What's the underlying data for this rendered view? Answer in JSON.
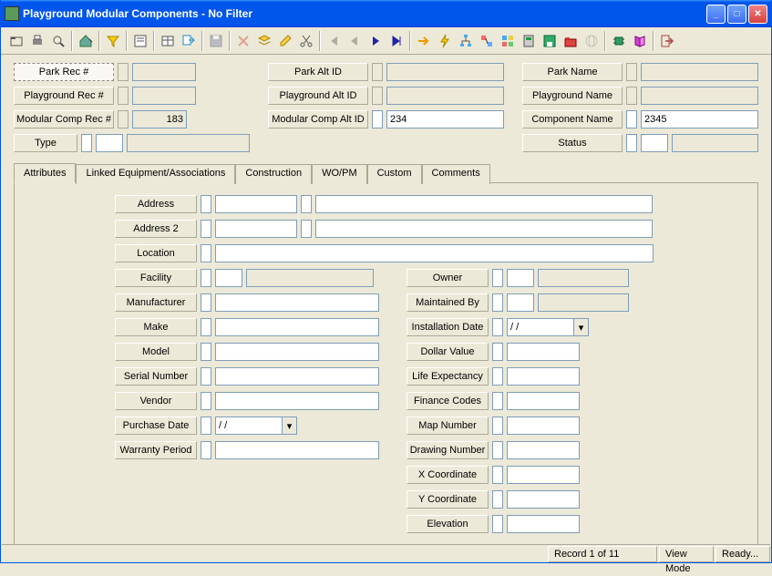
{
  "window": {
    "title": "Playground Modular Components - No Filter"
  },
  "toolbar_icons": [
    "open",
    "print",
    "preview",
    "home",
    "filter",
    "sort",
    "form",
    "table",
    "export",
    "save",
    "delete",
    "layers",
    "edit",
    "cut",
    "first",
    "prev",
    "next",
    "last",
    "goto",
    "flash",
    "tree",
    "link",
    "grid",
    "calc",
    "disk",
    "folder",
    "globe",
    "chip",
    "book",
    "exit"
  ],
  "header": {
    "park_rec": {
      "label": "Park Rec #",
      "value": ""
    },
    "park_alt": {
      "label": "Park Alt ID",
      "value": ""
    },
    "park_name": {
      "label": "Park Name",
      "value": ""
    },
    "pg_rec": {
      "label": "Playground Rec #",
      "value": ""
    },
    "pg_alt": {
      "label": "Playground Alt ID",
      "value": ""
    },
    "pg_name": {
      "label": "Playground Name",
      "value": ""
    },
    "mc_rec": {
      "label": "Modular Comp Rec #",
      "value": "183"
    },
    "mc_alt": {
      "label": "Modular Comp Alt ID",
      "value": "234"
    },
    "comp_name": {
      "label": "Component Name",
      "value": "2345"
    },
    "type": {
      "label": "Type",
      "value": ""
    },
    "status": {
      "label": "Status",
      "value": ""
    }
  },
  "tabs": [
    "Attributes",
    "Linked Equipment/Associations",
    "Construction",
    "WO/PM",
    "Custom",
    "Comments"
  ],
  "attr": {
    "left": {
      "address": {
        "label": "Address",
        "value": ""
      },
      "address2": {
        "label": "Address 2",
        "value": ""
      },
      "location": {
        "label": "Location",
        "value": ""
      },
      "facility": {
        "label": "Facility",
        "value": ""
      },
      "manufacturer": {
        "label": "Manufacturer",
        "value": ""
      },
      "make": {
        "label": "Make",
        "value": ""
      },
      "model": {
        "label": "Model",
        "value": ""
      },
      "serial": {
        "label": "Serial Number",
        "value": ""
      },
      "vendor": {
        "label": "Vendor",
        "value": ""
      },
      "purchase_date": {
        "label": "Purchase Date",
        "value": "  /  /"
      },
      "warranty": {
        "label": "Warranty Period",
        "value": ""
      }
    },
    "right": {
      "owner": {
        "label": "Owner",
        "value": ""
      },
      "maintained": {
        "label": "Maintained By",
        "value": ""
      },
      "install_date": {
        "label": "Installation Date",
        "value": "  /  /"
      },
      "dollar": {
        "label": "Dollar Value",
        "value": ""
      },
      "life": {
        "label": "Life Expectancy",
        "value": ""
      },
      "finance": {
        "label": "Finance Codes",
        "value": ""
      },
      "map": {
        "label": "Map Number",
        "value": ""
      },
      "drawing": {
        "label": "Drawing Number",
        "value": ""
      },
      "x": {
        "label": "X Coordinate",
        "value": ""
      },
      "y": {
        "label": "Y Coordinate",
        "value": ""
      },
      "elev": {
        "label": "Elevation",
        "value": ""
      }
    }
  },
  "status": {
    "record": "Record 1 of 11",
    "mode": "View Mode",
    "ready": "Ready..."
  }
}
